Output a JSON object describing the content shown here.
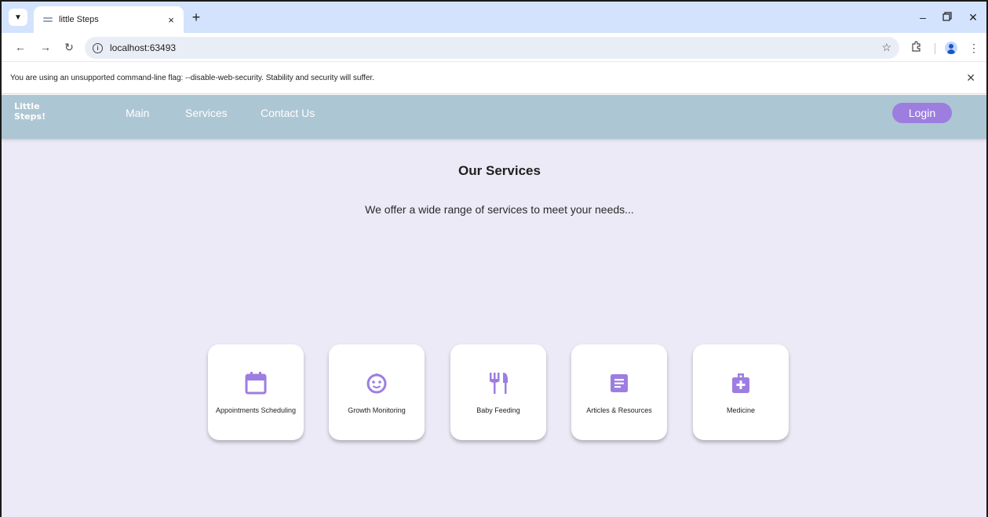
{
  "browser": {
    "tab_title": "little Steps",
    "tab_close": "×",
    "new_tab": "+",
    "url": "localhost:63493",
    "infobar_message": "You are using an unsupported command-line flag: --disable-web-security. Stability and security will suffer."
  },
  "app": {
    "logo_line1": "Little",
    "logo_line2": "Steps!",
    "nav": [
      "Main",
      "Services",
      "Contact Us"
    ],
    "login_label": "Login",
    "accent_color": "#9d7ee0",
    "appbar_color": "#adc6d3",
    "background_color": "#eceaf6"
  },
  "main": {
    "title": "Our Services",
    "subtitle": "We offer a wide range of services to meet your needs..."
  },
  "services": [
    {
      "label": "Appointments Scheduling",
      "icon": "calendar-icon"
    },
    {
      "label": "Growth Monitoring",
      "icon": "baby-face-icon"
    },
    {
      "label": "Baby Feeding",
      "icon": "restaurant-icon"
    },
    {
      "label": "Articles & Resources",
      "icon": "article-icon"
    },
    {
      "label": "Medicine",
      "icon": "medical-bag-icon"
    }
  ]
}
